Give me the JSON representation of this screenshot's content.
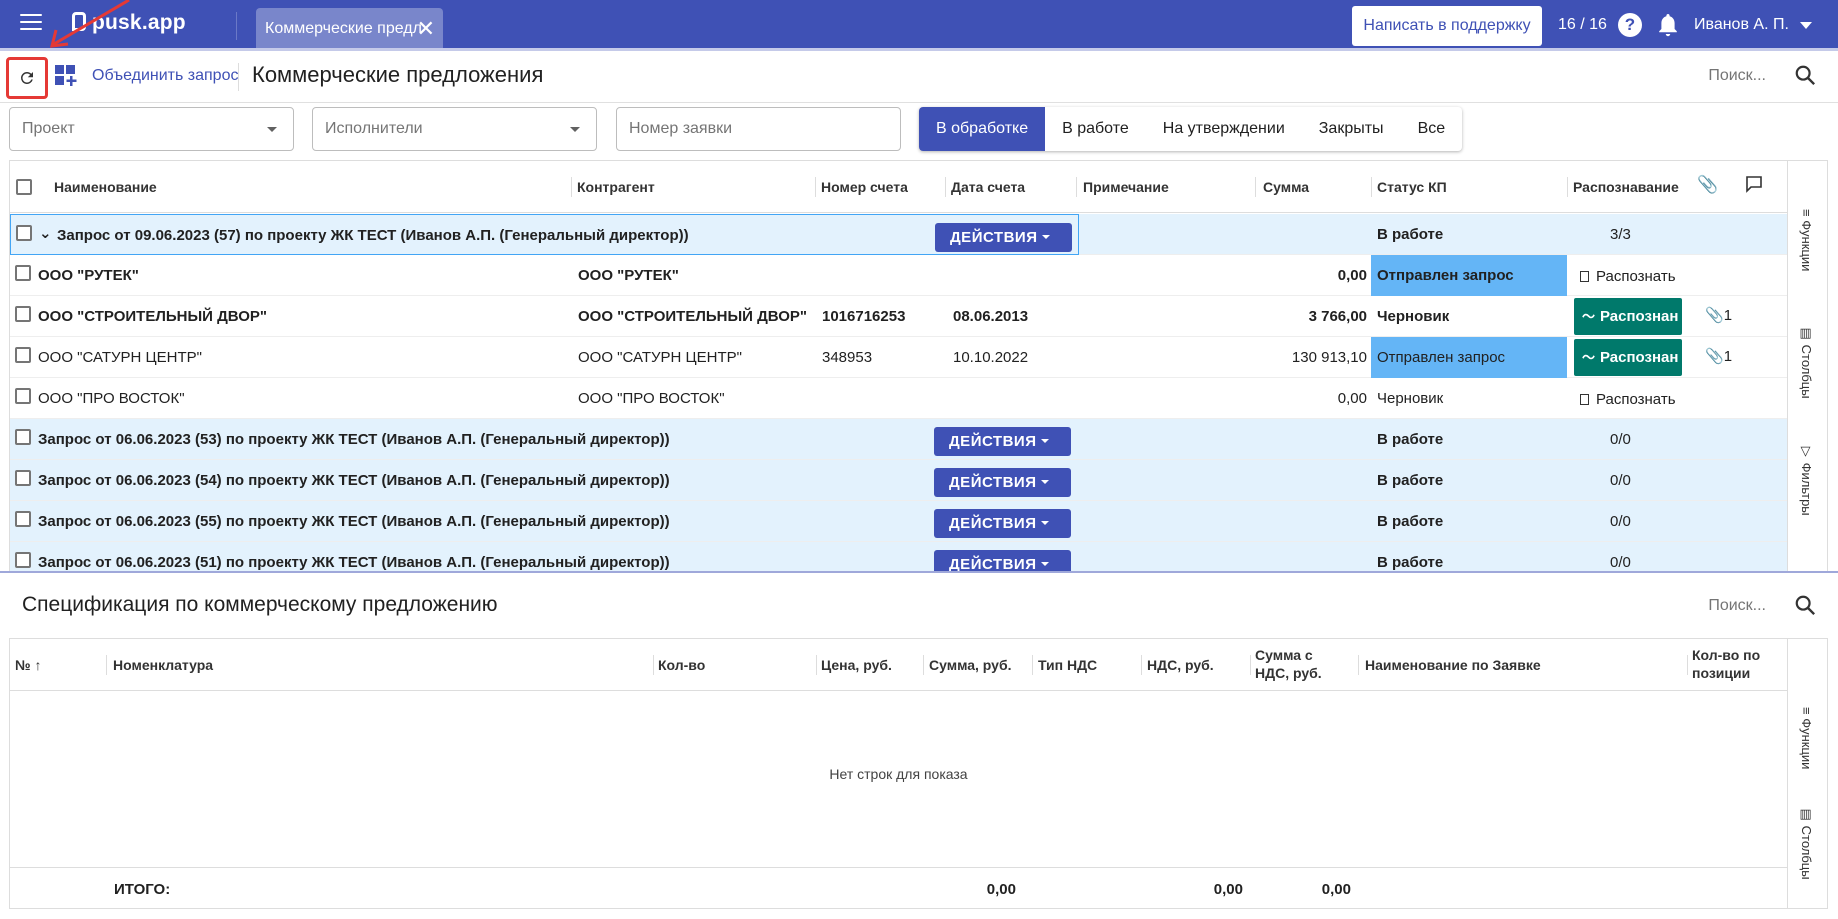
{
  "app": {
    "logo": "pusk.app",
    "tab_label": "Коммерческие предл",
    "support_label": "Написать в поддержку",
    "counter": "16 / 16",
    "help_glyph": "?",
    "user_name": "Иванов А. П."
  },
  "toolbar": {
    "merge_label": "Объединить запрос",
    "page_title": "Коммерческие предложения",
    "search_placeholder": "Поиск..."
  },
  "filters": {
    "project_placeholder": "Проект",
    "executors_placeholder": "Исполнители",
    "request_number_placeholder": "Номер заявки",
    "status_tabs": [
      "В обработке",
      "В работе",
      "На утверждении",
      "Закрыты",
      "Все"
    ],
    "active_tab": "В обработке"
  },
  "grid1": {
    "columns": [
      "Наименование",
      "Контрагент",
      "Номер счета",
      "Дата счета",
      "Примечание",
      "Сумма",
      "Статус КП",
      "Распознавание"
    ],
    "actions_label": "ДЕЙСТВИЯ",
    "rows": [
      {
        "name": "Запрос от 09.06.2023 (57) по проекту ЖК ТЕСТ (Иванов А.П. (Генеральный директор))",
        "status": "В работе",
        "recog": "3/3"
      },
      {
        "name": "ООО \"РУТЕК\"",
        "contractor": "ООО \"РУТЕК\"",
        "sum": "0,00",
        "status": "Отправлен запрос",
        "recog": "Распознать"
      },
      {
        "name": "ООО \"СТРОИТЕЛЬНЫЙ ДВОР\"",
        "contractor": "ООО \"СТРОИТЕЛЬНЫЙ ДВОР\"",
        "invoice": "1016716253",
        "date": "08.06.2013",
        "sum": "3 766,00",
        "status": "Черновик",
        "recog": "Распознан",
        "attach": "1"
      },
      {
        "name": "ООО \"САТУРН ЦЕНТР\"",
        "contractor": "ООО \"САТУРН ЦЕНТР\"",
        "invoice": "348953",
        "date": "10.10.2022",
        "sum": "130 913,10",
        "status": "Отправлен запрос",
        "recog": "Распознан",
        "attach": "1"
      },
      {
        "name": "ООО \"ПРО ВОСТОК\"",
        "contractor": "ООО \"ПРО ВОСТОК\"",
        "sum": "0,00",
        "status": "Черновик",
        "recog": "Распознать"
      },
      {
        "name": "Запрос от 06.06.2023 (53) по проекту ЖК ТЕСТ (Иванов А.П. (Генеральный директор))",
        "status": "В работе",
        "recog": "0/0"
      },
      {
        "name": "Запрос от 06.06.2023 (54) по проекту ЖК ТЕСТ (Иванов А.П. (Генеральный директор))",
        "status": "В работе",
        "recog": "0/0"
      },
      {
        "name": "Запрос от 06.06.2023 (55) по проекту ЖК ТЕСТ (Иванов А.П. (Генеральный директор))",
        "status": "В работе",
        "recog": "0/0"
      },
      {
        "name": "Запрос от 06.06.2023 (51) по проекту ЖК ТЕСТ (Иванов А.П. (Генеральный директор))",
        "status": "В работе",
        "recog": "0/0"
      }
    ],
    "side": [
      "Функции",
      "Столбцы",
      "Фильтры"
    ]
  },
  "grid2": {
    "title": "Спецификация по коммерческому предложению",
    "search_placeholder": "Поиск...",
    "columns": [
      "№",
      "Номенклатура",
      "Кол-во",
      "Цена, руб.",
      "Сумма, руб.",
      "Тип НДС",
      "НДС, руб.",
      "Сумма с НДС, руб.",
      "Наименование по Заявке",
      "Кол-во по позиции"
    ],
    "empty_text": "Нет строк для показа",
    "total_label": "ИТОГО:",
    "totals": [
      "0,00",
      "0,00",
      "0,00"
    ],
    "side": [
      "Функции",
      "Столбцы"
    ]
  },
  "colors": {
    "primary": "#3f51b5",
    "status_blue": "#64b5f6",
    "recognized": "#00796b",
    "highlight": "#e53935"
  }
}
